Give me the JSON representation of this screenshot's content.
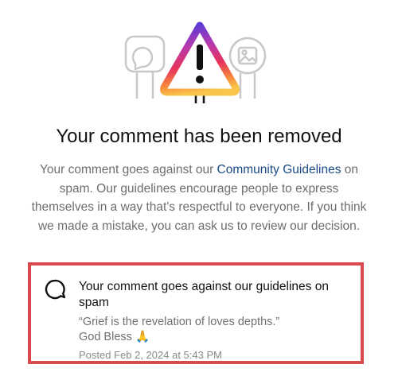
{
  "hero": {
    "illustration_icon": "warning-triangle-icon",
    "left_sign_icon": "speech-bubble-icon",
    "right_sign_icon": "image-icon",
    "gradient_colors": [
      "#5a3bd4",
      "#b63ab0",
      "#e8325c",
      "#f68c3b",
      "#f9c54b"
    ]
  },
  "title": "Your comment has been removed",
  "body": {
    "text_before": "Your comment goes against our ",
    "link_label": "Community Guidelines",
    "text_after": " on spam. Our guidelines encourage people to express themselves in a way that's respectful to everyone. If you think we made a mistake, you can ask us to review our decision."
  },
  "comment_card": {
    "icon": "comment-bubble-icon",
    "heading": "Your comment goes against our guidelines on spam",
    "quote_line_1": "“Grief is the revelation of loves depths.”",
    "quote_line_2": "God Bless",
    "emoji": "🙏",
    "posted": "Posted Feb 2, 2024 at 5:43 PM",
    "highlight_color": "#d94a4e"
  },
  "colors": {
    "link": "#1a4a86",
    "body_text": "#6d6d6d",
    "title_text": "#111111"
  }
}
